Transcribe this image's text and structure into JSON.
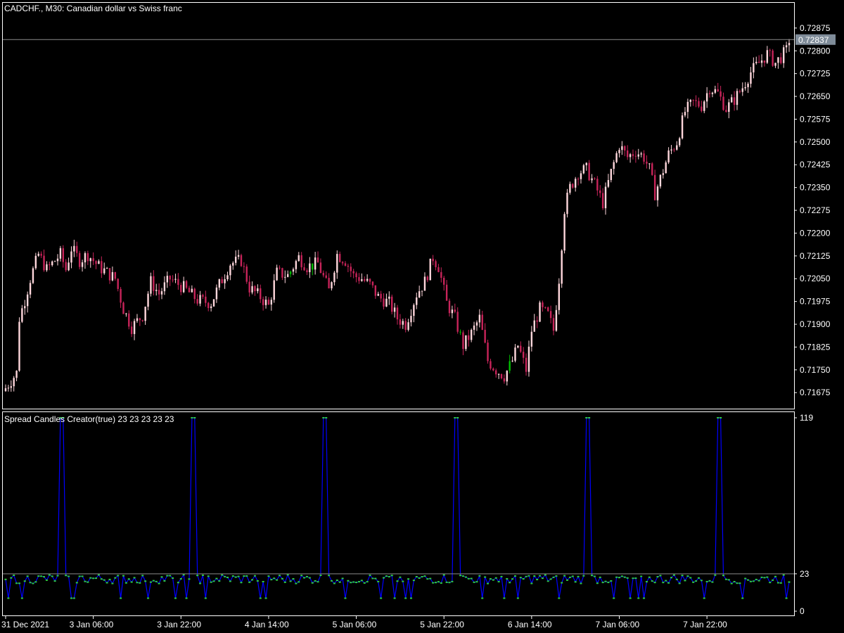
{
  "chart": {
    "title": "CADCHF., M30:  Canadian dollar vs Swiss franc",
    "current_price": "0.72837",
    "colors": {
      "background": "#000000",
      "frame": "#ffffff",
      "bull": "#ffd7dc",
      "bear": "#c8245a",
      "doji": "#00c000",
      "price_line": "#7f7f7f",
      "price_tag_bg": "#7f8c99",
      "spread_line": "#0000ff",
      "spread_points": "#2ecc40"
    }
  },
  "indicator": {
    "title": "Spread Candles Creator(true) 23 23 23 23 23",
    "level_label": "23"
  },
  "chart_data": [
    {
      "type": "candlestick",
      "title": "CADCHF., M30:  Canadian dollar vs Swiss franc",
      "ylim": [
        0.7162,
        0.72958
      ],
      "y_tick_labels": [
        "0.72875",
        "0.72800",
        "0.72725",
        "0.72650",
        "0.72575",
        "0.72500",
        "0.72425",
        "0.72350",
        "0.72275",
        "0.72200",
        "0.72125",
        "0.72050",
        "0.71975",
        "0.71900",
        "0.71825",
        "0.71750",
        "0.71675"
      ],
      "y_ticks": [
        0.72875,
        0.728,
        0.72725,
        0.7265,
        0.72575,
        0.725,
        0.72425,
        0.7235,
        0.72275,
        0.722,
        0.72125,
        0.7205,
        0.71975,
        0.719,
        0.71825,
        0.7175,
        0.71675
      ],
      "current_price": 0.72837,
      "bars": 287,
      "close_path": [
        [
          0,
          0.7169
        ],
        [
          4,
          0.7174
        ],
        [
          5,
          0.7192
        ],
        [
          7,
          0.7198
        ],
        [
          9,
          0.7205
        ],
        [
          12,
          0.7213
        ],
        [
          15,
          0.7208
        ],
        [
          20,
          0.7213
        ],
        [
          22,
          0.7208
        ],
        [
          24,
          0.7215
        ],
        [
          27,
          0.7211
        ],
        [
          30,
          0.7213
        ],
        [
          34,
          0.7209
        ],
        [
          40,
          0.7205
        ],
        [
          43,
          0.7195
        ],
        [
          46,
          0.7189
        ],
        [
          50,
          0.7193
        ],
        [
          53,
          0.7204
        ],
        [
          56,
          0.72
        ],
        [
          60,
          0.7205
        ],
        [
          65,
          0.7202
        ],
        [
          70,
          0.7198
        ],
        [
          75,
          0.7197
        ],
        [
          78,
          0.7203
        ],
        [
          82,
          0.721
        ],
        [
          86,
          0.7211
        ],
        [
          89,
          0.7202
        ],
        [
          93,
          0.7199
        ],
        [
          96,
          0.7196
        ],
        [
          99,
          0.7207
        ],
        [
          103,
          0.7206
        ],
        [
          107,
          0.7212
        ],
        [
          110,
          0.7209
        ],
        [
          114,
          0.721
        ],
        [
          118,
          0.7201
        ],
        [
          121,
          0.7213
        ],
        [
          124,
          0.7211
        ],
        [
          127,
          0.7206
        ],
        [
          130,
          0.7205
        ],
        [
          133,
          0.7203
        ],
        [
          136,
          0.7199
        ],
        [
          140,
          0.7197
        ],
        [
          143,
          0.7192
        ],
        [
          146,
          0.719
        ],
        [
          150,
          0.72
        ],
        [
          153,
          0.7204
        ],
        [
          156,
          0.7212
        ],
        [
          158,
          0.7209
        ],
        [
          161,
          0.7197
        ],
        [
          164,
          0.7192
        ],
        [
          167,
          0.7183
        ],
        [
          170,
          0.7187
        ],
        [
          173,
          0.7192
        ],
        [
          176,
          0.7178
        ],
        [
          179,
          0.7175
        ],
        [
          182,
          0.7173
        ],
        [
          185,
          0.7178
        ],
        [
          187,
          0.7183
        ],
        [
          190,
          0.7175
        ],
        [
          192,
          0.7188
        ],
        [
          195,
          0.7195
        ],
        [
          198,
          0.7193
        ],
        [
          200,
          0.7188
        ],
        [
          202,
          0.7205
        ],
        [
          204,
          0.7228
        ],
        [
          206,
          0.7235
        ],
        [
          209,
          0.724
        ],
        [
          212,
          0.7241
        ],
        [
          215,
          0.7236
        ],
        [
          218,
          0.723
        ],
        [
          221,
          0.724
        ],
        [
          224,
          0.7249
        ],
        [
          227,
          0.7245
        ],
        [
          230,
          0.7247
        ],
        [
          233,
          0.7245
        ],
        [
          235,
          0.7241
        ],
        [
          237,
          0.7233
        ],
        [
          239,
          0.7238
        ],
        [
          242,
          0.7246
        ],
        [
          245,
          0.725
        ],
        [
          248,
          0.726
        ],
        [
          251,
          0.7263
        ],
        [
          254,
          0.7262
        ],
        [
          257,
          0.7268
        ],
        [
          260,
          0.7266
        ],
        [
          263,
          0.7261
        ],
        [
          266,
          0.7264
        ],
        [
          269,
          0.7268
        ],
        [
          272,
          0.7273
        ],
        [
          275,
          0.7276
        ],
        [
          278,
          0.7279
        ],
        [
          281,
          0.7276
        ],
        [
          283,
          0.7278
        ],
        [
          285,
          0.728
        ],
        [
          286,
          0.72837
        ]
      ]
    },
    {
      "type": "line",
      "title": "Spread Candles Creator(true) 23 23 23 23 23",
      "ylim": [
        0,
        119
      ],
      "y_tick_labels": [
        "119",
        "23",
        "0"
      ],
      "level": 23,
      "x_tick_labels": [
        "31 Dec 2021",
        "3 Jan 06:00",
        "3 Jan 22:00",
        "4 Jan 14:00",
        "5 Jan 06:00",
        "5 Jan 22:00",
        "6 Jan 14:00",
        "7 Jan 06:00",
        "7 Jan 22:00"
      ],
      "x_tick_bars": [
        0,
        32,
        64,
        96,
        128,
        160,
        192,
        224,
        256
      ],
      "spikes": [
        {
          "bar": 20,
          "value": 119
        },
        {
          "bar": 68,
          "value": 119
        },
        {
          "bar": 116,
          "value": 119
        },
        {
          "bar": 164,
          "value": 119
        },
        {
          "bar": 212,
          "value": 119
        },
        {
          "bar": 260,
          "value": 119
        }
      ],
      "typical_value": 20
    }
  ]
}
